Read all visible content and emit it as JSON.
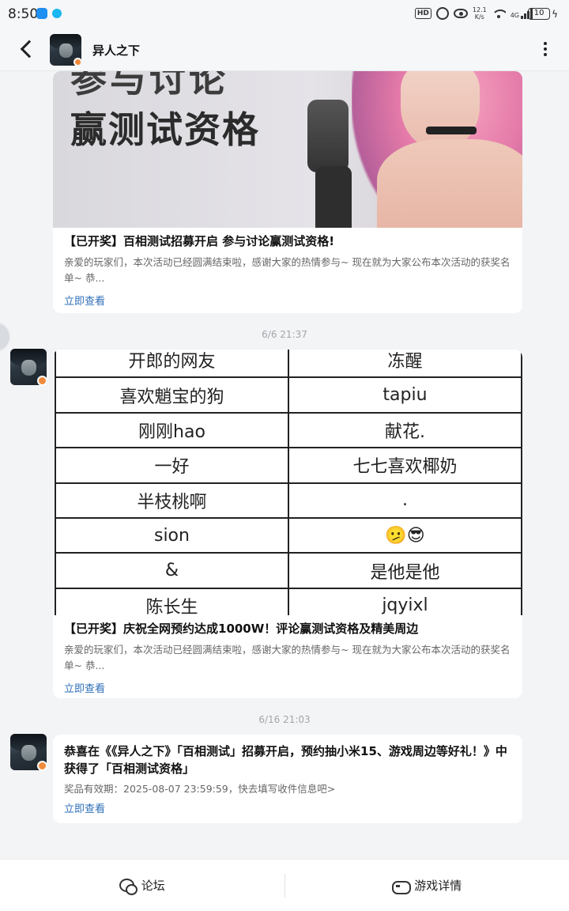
{
  "status_bar": {
    "time": "8:50",
    "hd": "HD",
    "net_speed_value": "12.1",
    "net_speed_unit": "K/s",
    "network": "4G",
    "battery": "10",
    "colors": {
      "notif_1": "#1f8ff0",
      "notif_2": "#1ab7f0"
    }
  },
  "header": {
    "title": "异人之下",
    "back_icon": "chevron-left-icon",
    "more_icon": "more-vertical-icon"
  },
  "messages": [
    {
      "banner_text_line1": "参与讨论",
      "banner_text_line2": "赢测试资格",
      "title": "【已开奖】百相测试招募开启 参与讨论赢测试资格!",
      "description": "亲爱的玩家们，本次活动已经圆满结束啦，感谢大家的热情参与~ 现在就为大家公布本次活动的获奖名单~ 恭...",
      "link": "立即查看"
    },
    {
      "timestamp": "6/6  21:37",
      "image_table": [
        [
          "开郎的网友",
          "冻醒"
        ],
        [
          "喜欢魈宝的狗",
          "tapiu"
        ],
        [
          "刚刚hao",
          "献花."
        ],
        [
          "一好",
          "七七喜欢椰奶"
        ],
        [
          "半枝桃啊",
          "."
        ],
        [
          "sion",
          "🫤😎"
        ],
        [
          "&",
          "是他是他"
        ],
        [
          "陈长生",
          "jqyixl"
        ]
      ],
      "title": "【已开奖】庆祝全网预约达成1000W！评论赢测试资格及精美周边",
      "description": "亲爱的玩家们，本次活动已经圆满结束啦，感谢大家的热情参与~ 现在就为大家公布本次活动的获奖名单~ 恭...",
      "link": "立即查看"
    },
    {
      "timestamp": "6/16  21:03",
      "title": "恭喜在《《异人之下》「百相测试」招募开启，预约抽小米15、游戏周边等好礼！》中获得了「百相测试资格」",
      "expiry": "奖品有效期：2025-08-07 23:59:59，快去填写收件信息吧>",
      "link": "立即查看"
    }
  ],
  "bottom_nav": {
    "forum_label": "论坛",
    "forum_icon": "chat-bubbles-icon",
    "game_label": "游戏详情",
    "game_icon": "gamepad-icon"
  },
  "colors": {
    "link": "#2f6fb8",
    "background": "#f3f4f6",
    "card": "#ffffff"
  }
}
